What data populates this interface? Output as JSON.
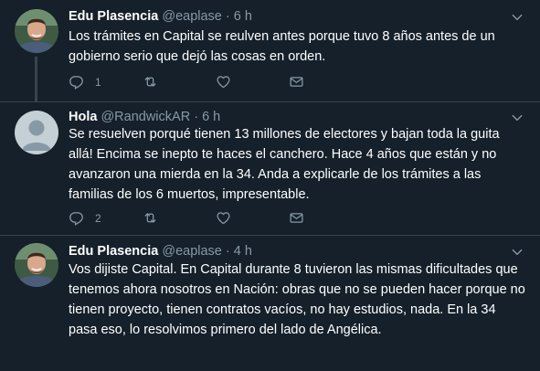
{
  "colors": {
    "background": "#15202b",
    "muted": "#8899a6",
    "border": "#38444d",
    "text": "#ffffff"
  },
  "tweets": [
    {
      "name": "Edu Plasencia",
      "handle": "@eaplase",
      "dot": "·",
      "time": "6 h",
      "text": "Los trámites en Capital se reulven antes porque tuvo 8 años antes de un gobierno serio que dejó las cosas en orden.",
      "reply_count": "1",
      "avatar": "photo"
    },
    {
      "name": "Hola",
      "handle": "@RandwickAR",
      "dot": "·",
      "time": "6 h",
      "text": "Se resuelven porqué tienen 13 millones de electores y bajan toda la guita allá! Encima se inepto te haces el canchero. Hace 4 años que están y no avanzaron una mierda en la 34. Anda a explicarle de los trámites a las familias de los 6 muertos, impresentable.",
      "reply_count": "2",
      "avatar": "default"
    },
    {
      "name": "Edu Plasencia",
      "handle": "@eaplase",
      "dot": "·",
      "time": "4 h",
      "text": "Vos dijiste Capital. En Capital durante 8 tuvieron las mismas dificultades que tenemos ahora nosotros en Nación: obras que no se pueden hacer porque no tienen proyecto, tienen contratos vacíos, no hay estudios, nada. En la 34 pasa eso, lo resolvimos primero del lado de Angélica.",
      "reply_count": "",
      "avatar": "photo"
    }
  ],
  "icons": {
    "reply": "reply-icon",
    "retweet": "retweet-icon",
    "like": "like-icon",
    "message": "direct-message-icon",
    "more": "chevron-down-icon"
  }
}
